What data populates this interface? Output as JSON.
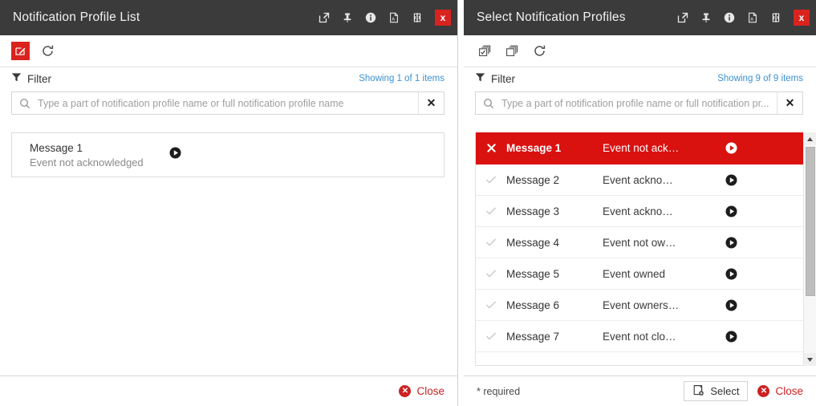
{
  "left_panel": {
    "title": "Notification Profile List",
    "title_icons": [
      {
        "name": "popout-icon",
        "label": "Open in new window"
      },
      {
        "name": "pin-icon",
        "label": "Pin"
      },
      {
        "name": "info-icon",
        "label": "Information"
      },
      {
        "name": "pdf-export-icon",
        "label": "Export to PDF"
      },
      {
        "name": "split-view-icon",
        "label": "Split view"
      }
    ],
    "close_icon_label": "x",
    "toolbar": [
      {
        "name": "edit-button",
        "label": "Edit"
      },
      {
        "name": "refresh-button",
        "label": "Refresh"
      }
    ],
    "filter": {
      "label": "Filter",
      "showing": "Showing 1 of 1 items",
      "placeholder": "Type a part of notification profile name or full notification profile name",
      "value": "",
      "clear_label": "✕"
    },
    "cards": [
      {
        "title": "Message 1",
        "subtitle": "Event not acknowledged"
      }
    ],
    "footer": {
      "close_label": "Close"
    }
  },
  "right_panel": {
    "title": "Select Notification Profiles",
    "title_icons": [
      {
        "name": "popout-icon",
        "label": "Open in new window"
      },
      {
        "name": "pin-icon",
        "label": "Pin"
      },
      {
        "name": "info-icon",
        "label": "Information"
      },
      {
        "name": "pdf-export-icon",
        "label": "Export to PDF"
      },
      {
        "name": "split-view-icon",
        "label": "Split view"
      }
    ],
    "close_icon_label": "x",
    "toolbar": [
      {
        "name": "select-all-button",
        "label": "Select all"
      },
      {
        "name": "deselect-all-button",
        "label": "Deselect all"
      },
      {
        "name": "refresh-button",
        "label": "Refresh"
      }
    ],
    "filter": {
      "label": "Filter",
      "showing": "Showing 9 of 9 items",
      "placeholder": "Type a part of notification profile name or full notification pr...",
      "value": "",
      "clear_label": "✕"
    },
    "rows": [
      {
        "name": "Message 1",
        "desc": "Event not ack…",
        "selected": true
      },
      {
        "name": "Message 2",
        "desc": "Event ackno…",
        "selected": false
      },
      {
        "name": "Message 3",
        "desc": "Event ackno…",
        "selected": false
      },
      {
        "name": "Message 4",
        "desc": "Event not ow…",
        "selected": false
      },
      {
        "name": "Message 5",
        "desc": "Event owned",
        "selected": false
      },
      {
        "name": "Message 6",
        "desc": "Event owners…",
        "selected": false
      },
      {
        "name": "Message 7",
        "desc": "Event not clo…",
        "selected": false
      }
    ],
    "footer": {
      "required_note": "* required",
      "select_label": "Select",
      "close_label": "Close"
    }
  },
  "colors": {
    "titlebar_bg": "#3b3b3b",
    "accent_red": "#d9231e",
    "selected_row": "#d9110f",
    "link_blue": "#3b91d4",
    "close_red": "#cc2222"
  }
}
